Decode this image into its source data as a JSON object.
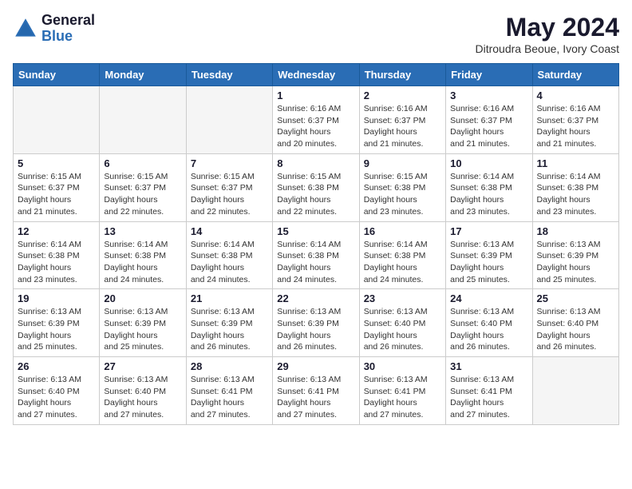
{
  "header": {
    "logo_general": "General",
    "logo_blue": "Blue",
    "main_title": "May 2024",
    "subtitle": "Ditroudra Beoue, Ivory Coast"
  },
  "days_of_week": [
    "Sunday",
    "Monday",
    "Tuesday",
    "Wednesday",
    "Thursday",
    "Friday",
    "Saturday"
  ],
  "weeks": [
    [
      {
        "day": "",
        "empty": true
      },
      {
        "day": "",
        "empty": true
      },
      {
        "day": "",
        "empty": true
      },
      {
        "day": "1",
        "sunrise": "6:16 AM",
        "sunset": "6:37 PM",
        "daylight": "12 hours and 20 minutes."
      },
      {
        "day": "2",
        "sunrise": "6:16 AM",
        "sunset": "6:37 PM",
        "daylight": "12 hours and 21 minutes."
      },
      {
        "day": "3",
        "sunrise": "6:16 AM",
        "sunset": "6:37 PM",
        "daylight": "12 hours and 21 minutes."
      },
      {
        "day": "4",
        "sunrise": "6:16 AM",
        "sunset": "6:37 PM",
        "daylight": "12 hours and 21 minutes."
      }
    ],
    [
      {
        "day": "5",
        "sunrise": "6:15 AM",
        "sunset": "6:37 PM",
        "daylight": "12 hours and 21 minutes."
      },
      {
        "day": "6",
        "sunrise": "6:15 AM",
        "sunset": "6:37 PM",
        "daylight": "12 hours and 22 minutes."
      },
      {
        "day": "7",
        "sunrise": "6:15 AM",
        "sunset": "6:37 PM",
        "daylight": "12 hours and 22 minutes."
      },
      {
        "day": "8",
        "sunrise": "6:15 AM",
        "sunset": "6:38 PM",
        "daylight": "12 hours and 22 minutes."
      },
      {
        "day": "9",
        "sunrise": "6:15 AM",
        "sunset": "6:38 PM",
        "daylight": "12 hours and 23 minutes."
      },
      {
        "day": "10",
        "sunrise": "6:14 AM",
        "sunset": "6:38 PM",
        "daylight": "12 hours and 23 minutes."
      },
      {
        "day": "11",
        "sunrise": "6:14 AM",
        "sunset": "6:38 PM",
        "daylight": "12 hours and 23 minutes."
      }
    ],
    [
      {
        "day": "12",
        "sunrise": "6:14 AM",
        "sunset": "6:38 PM",
        "daylight": "12 hours and 23 minutes."
      },
      {
        "day": "13",
        "sunrise": "6:14 AM",
        "sunset": "6:38 PM",
        "daylight": "12 hours and 24 minutes."
      },
      {
        "day": "14",
        "sunrise": "6:14 AM",
        "sunset": "6:38 PM",
        "daylight": "12 hours and 24 minutes."
      },
      {
        "day": "15",
        "sunrise": "6:14 AM",
        "sunset": "6:38 PM",
        "daylight": "12 hours and 24 minutes."
      },
      {
        "day": "16",
        "sunrise": "6:14 AM",
        "sunset": "6:38 PM",
        "daylight": "12 hours and 24 minutes."
      },
      {
        "day": "17",
        "sunrise": "6:13 AM",
        "sunset": "6:39 PM",
        "daylight": "12 hours and 25 minutes."
      },
      {
        "day": "18",
        "sunrise": "6:13 AM",
        "sunset": "6:39 PM",
        "daylight": "12 hours and 25 minutes."
      }
    ],
    [
      {
        "day": "19",
        "sunrise": "6:13 AM",
        "sunset": "6:39 PM",
        "daylight": "12 hours and 25 minutes."
      },
      {
        "day": "20",
        "sunrise": "6:13 AM",
        "sunset": "6:39 PM",
        "daylight": "12 hours and 25 minutes."
      },
      {
        "day": "21",
        "sunrise": "6:13 AM",
        "sunset": "6:39 PM",
        "daylight": "12 hours and 26 minutes."
      },
      {
        "day": "22",
        "sunrise": "6:13 AM",
        "sunset": "6:39 PM",
        "daylight": "12 hours and 26 minutes."
      },
      {
        "day": "23",
        "sunrise": "6:13 AM",
        "sunset": "6:40 PM",
        "daylight": "12 hours and 26 minutes."
      },
      {
        "day": "24",
        "sunrise": "6:13 AM",
        "sunset": "6:40 PM",
        "daylight": "12 hours and 26 minutes."
      },
      {
        "day": "25",
        "sunrise": "6:13 AM",
        "sunset": "6:40 PM",
        "daylight": "12 hours and 26 minutes."
      }
    ],
    [
      {
        "day": "26",
        "sunrise": "6:13 AM",
        "sunset": "6:40 PM",
        "daylight": "12 hours and 27 minutes."
      },
      {
        "day": "27",
        "sunrise": "6:13 AM",
        "sunset": "6:40 PM",
        "daylight": "12 hours and 27 minutes."
      },
      {
        "day": "28",
        "sunrise": "6:13 AM",
        "sunset": "6:41 PM",
        "daylight": "12 hours and 27 minutes."
      },
      {
        "day": "29",
        "sunrise": "6:13 AM",
        "sunset": "6:41 PM",
        "daylight": "12 hours and 27 minutes."
      },
      {
        "day": "30",
        "sunrise": "6:13 AM",
        "sunset": "6:41 PM",
        "daylight": "12 hours and 27 minutes."
      },
      {
        "day": "31",
        "sunrise": "6:13 AM",
        "sunset": "6:41 PM",
        "daylight": "12 hours and 27 minutes."
      },
      {
        "day": "",
        "empty": true
      }
    ]
  ],
  "labels": {
    "sunrise": "Sunrise:",
    "sunset": "Sunset:",
    "daylight": "Daylight hours"
  }
}
